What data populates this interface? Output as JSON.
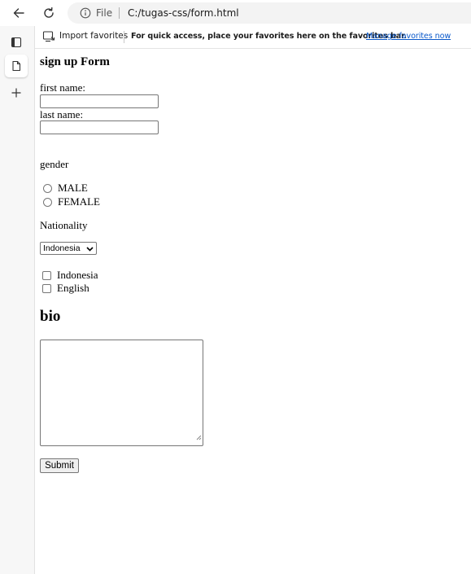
{
  "browser": {
    "file_label": "File",
    "url": "C:/tugas-css/form.html"
  },
  "favorites_bar": {
    "import_label": "Import favorites",
    "message": "For quick access, place your favorites here on the favorites bar.",
    "manage_link": "Manage favorites now"
  },
  "form": {
    "title": "sign up Form",
    "first_name_label": "first name:",
    "first_name_value": "",
    "last_name_label": "last name:",
    "last_name_value": "",
    "gender_label": "gender",
    "gender_options": [
      "MALE",
      "FEMALE"
    ],
    "nationality_label": "Nationality",
    "nationality_selected": "Indonesia",
    "language_options": [
      "Indonesia",
      "English"
    ],
    "bio_title": "bio",
    "bio_value": "",
    "submit_label": "Submit"
  },
  "icons": {
    "back": "back-arrow-icon",
    "refresh": "refresh-icon",
    "info": "info-icon",
    "import": "import-favorites-icon",
    "tab_actions": "tab-actions-icon",
    "page": "page-icon",
    "new_tab": "plus-icon"
  }
}
